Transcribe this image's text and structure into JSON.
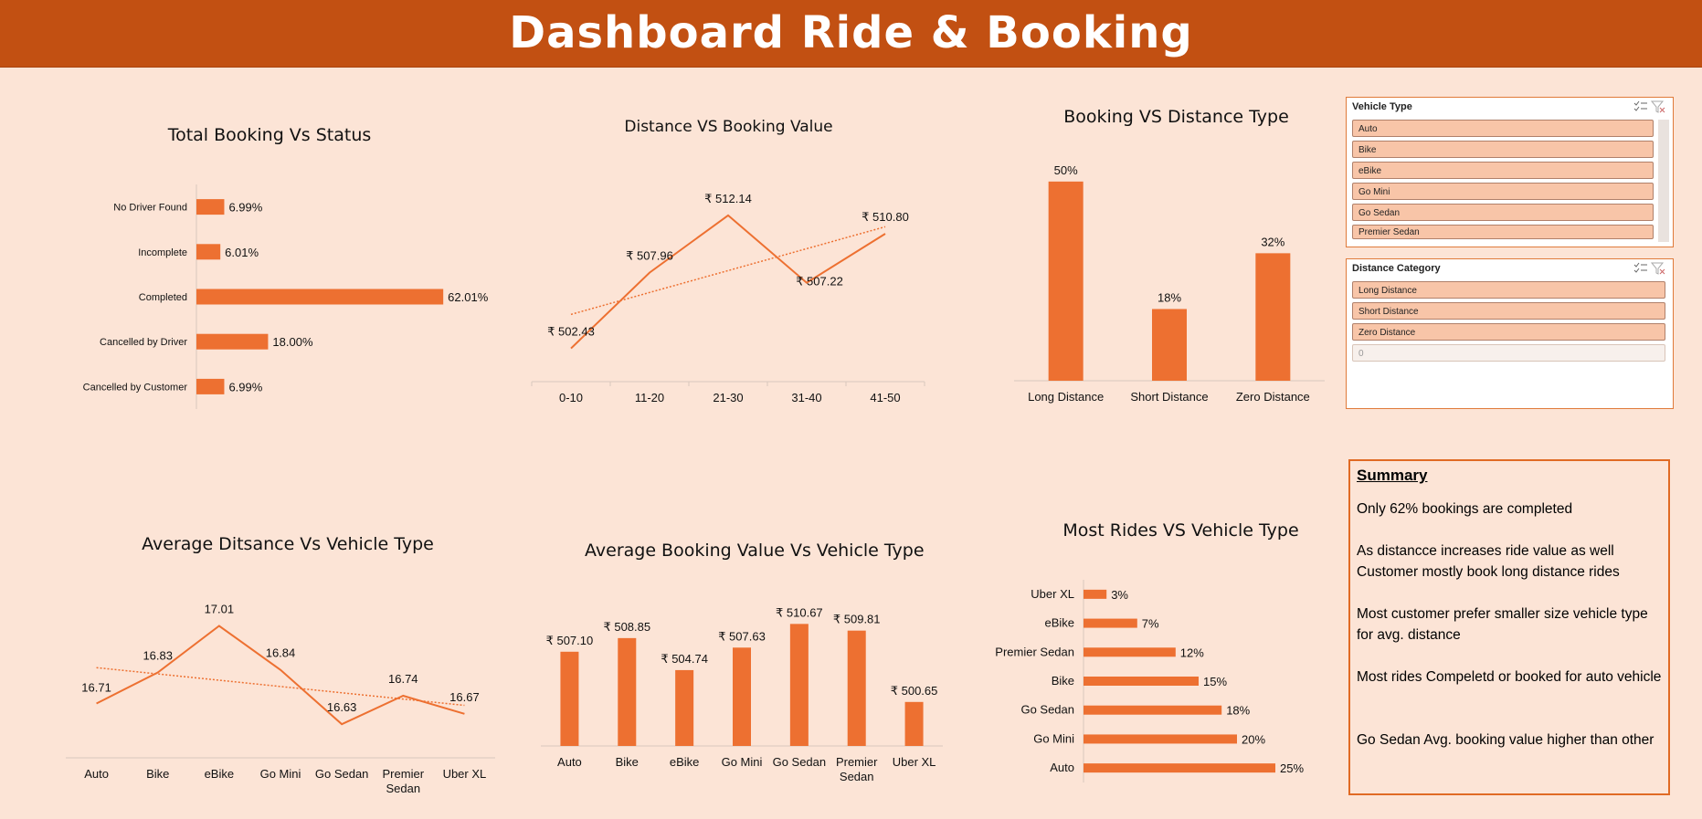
{
  "dashboard_title": "Dashboard Ride & Booking",
  "colors": {
    "bar": "#ed7031",
    "banner": "#c25012",
    "background": "#fce4d6"
  },
  "chart_data": [
    {
      "id": "status",
      "type": "bar",
      "orientation": "horizontal",
      "title": "Total Booking Vs Status",
      "categories": [
        "No Driver Found",
        "Incomplete",
        "Completed",
        "Cancelled by Driver",
        "Cancelled by Customer"
      ],
      "values": [
        6.99,
        6.01,
        62.01,
        18.0,
        6.99
      ],
      "labels": [
        "6.99%",
        "6.01%",
        "62.01%",
        "18.00%",
        "6.99%"
      ],
      "xlim": [
        0,
        70
      ]
    },
    {
      "id": "distance_value",
      "type": "line",
      "title": "Distance VS Booking Value",
      "categories": [
        "0-10",
        "11-20",
        "21-30",
        "31-40",
        "41-50"
      ],
      "values": [
        502.43,
        507.96,
        512.14,
        507.22,
        510.8
      ],
      "labels": [
        "₹ 502.43",
        "₹ 507.96",
        "₹ 512.14",
        "₹ 507.22",
        "₹ 510.80"
      ],
      "trendline": "linear",
      "ylim": [
        500,
        514
      ]
    },
    {
      "id": "distance_type",
      "type": "bar",
      "title": "Booking VS  Distance Type",
      "categories": [
        "Long Distance",
        "Short Distance",
        "Zero Distance"
      ],
      "values": [
        50,
        18,
        32
      ],
      "labels": [
        "50%",
        "18%",
        "32%"
      ],
      "ylim": [
        0,
        55
      ]
    },
    {
      "id": "avg_distance",
      "type": "line",
      "title": "Average Ditsance Vs  Vehicle Type",
      "categories": [
        "Auto",
        "Bike",
        "eBike",
        "Go Mini",
        "Go Sedan",
        "Premier Sedan",
        "Uber XL"
      ],
      "values": [
        16.71,
        16.83,
        17.01,
        16.84,
        16.63,
        16.74,
        16.67
      ],
      "labels": [
        "16.71",
        "16.83",
        "17.01",
        "16.84",
        "16.63",
        "16.74",
        "16.67"
      ],
      "trendline": "linear",
      "ylim": [
        16.5,
        17.1
      ]
    },
    {
      "id": "avg_value",
      "type": "bar",
      "title": "Average Booking Value Vs Vehicle Type",
      "categories": [
        "Auto",
        "Bike",
        "eBike",
        "Go Mini",
        "Go Sedan",
        "Premier Sedan",
        "Uber XL"
      ],
      "values": [
        507.1,
        508.85,
        504.74,
        507.63,
        510.67,
        509.81,
        500.65
      ],
      "labels": [
        "₹ 507.10",
        "₹ 508.85",
        "₹ 504.74",
        "₹ 507.63",
        "₹ 510.67",
        "₹ 509.81",
        "₹ 500.65"
      ],
      "ylim": [
        495,
        512
      ]
    },
    {
      "id": "most_rides",
      "type": "bar",
      "orientation": "horizontal",
      "title": "Most Rides VS Vehicle Type",
      "categories": [
        "Uber XL",
        "eBike",
        "Premier Sedan",
        "Bike",
        "Go Sedan",
        "Go Mini",
        "Auto"
      ],
      "values": [
        3,
        7,
        12,
        15,
        18,
        20,
        25
      ],
      "labels": [
        "3%",
        "7%",
        "12%",
        "15%",
        "18%",
        "20%",
        "25%"
      ],
      "xlim": [
        0,
        25
      ]
    }
  ],
  "slicers": {
    "vehicle_type": {
      "title": "Vehicle Type",
      "items": [
        "Auto",
        "Bike",
        "eBike",
        "Go Mini",
        "Go Sedan",
        "Premier Sedan"
      ]
    },
    "distance_category": {
      "title": "Distance Category",
      "items": [
        "Long Distance",
        "Short Distance",
        "Zero Distance",
        "0"
      ]
    }
  },
  "summary": {
    "title": "Summary",
    "lines": [
      "Only 62% bookings are completed",
      "As distancce increases ride value as well",
      "Customer mostly book long distance rides",
      "Most customer prefer smaller size vehicle type for avg. distance",
      "Most rides Compeletd or booked for auto vehicle",
      "Go Sedan Avg. booking value higher than other"
    ]
  }
}
